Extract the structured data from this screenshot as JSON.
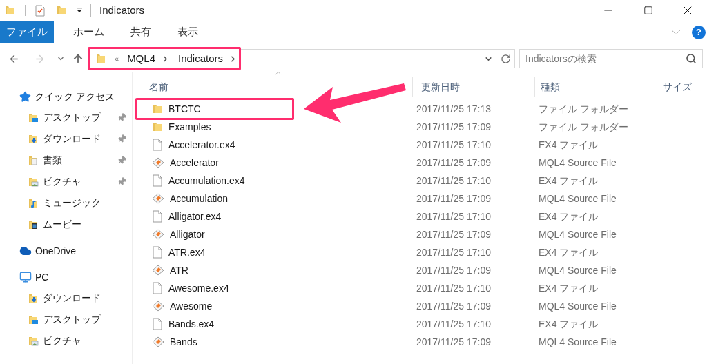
{
  "window": {
    "title": "Indicators"
  },
  "ribbon": {
    "tabs": [
      {
        "label": "ファイル",
        "selected": true
      },
      {
        "label": "ホーム",
        "selected": false
      },
      {
        "label": "共有",
        "selected": false
      },
      {
        "label": "表示",
        "selected": false
      }
    ],
    "help": "?"
  },
  "navigation": {
    "forward": {
      "disabled": true
    }
  },
  "address": {
    "highlighted": true,
    "overflow": "«",
    "crumbs": [
      "MQL4",
      "Indicators"
    ]
  },
  "search": {
    "placeholder": "Indicatorsの検索"
  },
  "callout_arrow": true,
  "sidebar": {
    "sections": [
      {
        "label": "クイック アクセス",
        "kind": "star",
        "children": [
          {
            "label": "デスクトップ",
            "kind": "desktop",
            "pinned": true
          },
          {
            "label": "ダウンロード",
            "kind": "download",
            "pinned": true
          },
          {
            "label": "書類",
            "kind": "documents",
            "pinned": true
          },
          {
            "label": "ピクチャ",
            "kind": "pictures",
            "pinned": true
          },
          {
            "label": "ミュージック",
            "kind": "music",
            "pinned": false
          },
          {
            "label": "ムービー",
            "kind": "video",
            "pinned": false
          }
        ]
      },
      {
        "label": "OneDrive",
        "kind": "cloud"
      },
      {
        "label": "PC",
        "kind": "pc",
        "children": [
          {
            "label": "ダウンロード",
            "kind": "download",
            "pinned": false
          },
          {
            "label": "デスクトップ",
            "kind": "desktop",
            "pinned": false
          },
          {
            "label": "ピクチャ",
            "kind": "pictures",
            "pinned": false
          }
        ]
      }
    ]
  },
  "table": {
    "columns": [
      "名前",
      "更新日時",
      "種類",
      "サイズ"
    ],
    "rows": [
      {
        "name": "BTCTC",
        "date": "2017/11/25 17:13",
        "type": "ファイル フォルダー",
        "kind": "folder",
        "highlighted": true
      },
      {
        "name": "Examples",
        "date": "2017/11/25 17:09",
        "type": "ファイル フォルダー",
        "kind": "folder",
        "highlighted": false
      },
      {
        "name": "Accelerator.ex4",
        "date": "2017/11/25 17:10",
        "type": "EX4 ファイル",
        "kind": "ex4",
        "highlighted": false
      },
      {
        "name": "Accelerator",
        "date": "2017/11/25 17:09",
        "type": "MQL4 Source File",
        "kind": "mq4",
        "highlighted": false
      },
      {
        "name": "Accumulation.ex4",
        "date": "2017/11/25 17:10",
        "type": "EX4 ファイル",
        "kind": "ex4",
        "highlighted": false
      },
      {
        "name": "Accumulation",
        "date": "2017/11/25 17:09",
        "type": "MQL4 Source File",
        "kind": "mq4",
        "highlighted": false
      },
      {
        "name": "Alligator.ex4",
        "date": "2017/11/25 17:10",
        "type": "EX4 ファイル",
        "kind": "ex4",
        "highlighted": false
      },
      {
        "name": "Alligator",
        "date": "2017/11/25 17:09",
        "type": "MQL4 Source File",
        "kind": "mq4",
        "highlighted": false
      },
      {
        "name": "ATR.ex4",
        "date": "2017/11/25 17:10",
        "type": "EX4 ファイル",
        "kind": "ex4",
        "highlighted": false
      },
      {
        "name": "ATR",
        "date": "2017/11/25 17:09",
        "type": "MQL4 Source File",
        "kind": "mq4",
        "highlighted": false
      },
      {
        "name": "Awesome.ex4",
        "date": "2017/11/25 17:10",
        "type": "EX4 ファイル",
        "kind": "ex4",
        "highlighted": false
      },
      {
        "name": "Awesome",
        "date": "2017/11/25 17:09",
        "type": "MQL4 Source File",
        "kind": "mq4",
        "highlighted": false
      },
      {
        "name": "Bands.ex4",
        "date": "2017/11/25 17:10",
        "type": "EX4 ファイル",
        "kind": "ex4",
        "highlighted": false
      },
      {
        "name": "Bands",
        "date": "2017/11/25 17:09",
        "type": "MQL4 Source File",
        "kind": "mq4",
        "highlighted": false
      }
    ]
  }
}
